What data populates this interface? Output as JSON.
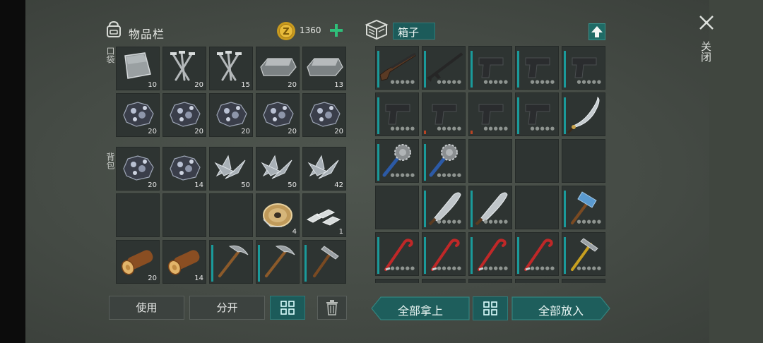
{
  "inventory": {
    "title": "物品栏",
    "coins": "1360",
    "pocket_label": "口袋",
    "backpack_label": "背包",
    "pocket": [
      {
        "icon": "metal-plate-icon",
        "count": "10"
      },
      {
        "icon": "nails-icon",
        "count": "20"
      },
      {
        "icon": "nails-icon",
        "count": "15"
      },
      {
        "icon": "iron-ingot-icon",
        "count": "20"
      },
      {
        "icon": "iron-ingot-icon",
        "count": "13"
      },
      {
        "icon": "coal-ore-icon",
        "count": "20"
      },
      {
        "icon": "coal-ore-icon",
        "count": "20"
      },
      {
        "icon": "coal-ore-icon",
        "count": "20"
      },
      {
        "icon": "coal-ore-icon",
        "count": "20"
      },
      {
        "icon": "coal-ore-icon",
        "count": "20"
      }
    ],
    "backpack": [
      {
        "icon": "coal-ore-icon",
        "count": "20"
      },
      {
        "icon": "coal-ore-icon",
        "count": "14"
      },
      {
        "icon": "scrap-metal-icon",
        "count": "50"
      },
      {
        "icon": "scrap-metal-icon",
        "count": "50"
      },
      {
        "icon": "scrap-metal-icon",
        "count": "42"
      },
      {
        "icon": "",
        "count": ""
      },
      {
        "icon": "",
        "count": ""
      },
      {
        "icon": "",
        "count": ""
      },
      {
        "icon": "wire-spool-icon",
        "count": "4"
      },
      {
        "icon": "aluminum-bars-icon",
        "count": "1"
      },
      {
        "icon": "log-icon",
        "count": "20"
      },
      {
        "icon": "log-icon",
        "count": "14"
      },
      {
        "icon": "pickaxe-icon",
        "count": ""
      },
      {
        "icon": "pickaxe-icon",
        "count": ""
      },
      {
        "icon": "hammer-icon",
        "count": ""
      }
    ],
    "use_label": "使用",
    "split_label": "分开"
  },
  "chest": {
    "title": "箱子",
    "take_all_label": "全部拿上",
    "put_all_label": "全部放入",
    "items": [
      "shotgun-icon",
      "rifle-icon",
      "pistol-icon",
      "pistol-icon",
      "pistol-icon",
      "pistol-icon",
      "pistol-icon",
      "pistol-icon",
      "pistol-icon",
      "katana-icon",
      "spiked-club-icon",
      "spiked-club-icon",
      "",
      "",
      "",
      "",
      "machete-icon",
      "machete-icon",
      "",
      "sledgehammer-icon",
      "crowbar-icon",
      "crowbar-icon",
      "crowbar-icon",
      "crowbar-icon",
      "hammer-icon"
    ]
  },
  "close_label": "关闭",
  "colors": {
    "accent_teal": "#1c5b5a",
    "durability": "#1a9a9a",
    "plus_green": "#2fbf7a"
  }
}
